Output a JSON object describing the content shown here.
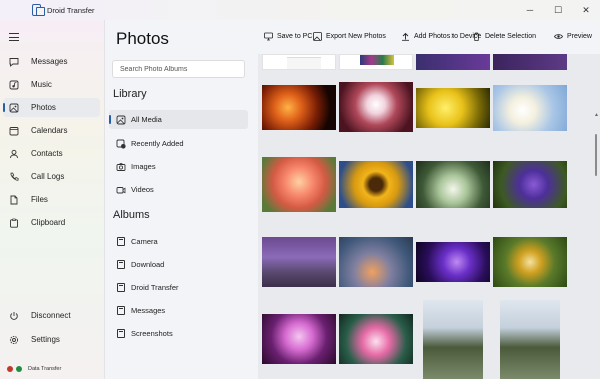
{
  "window": {
    "title": "Droid Transfer",
    "minimize_icon": "minimize-icon",
    "maximize_icon": "maximize-icon",
    "close_icon": "close-icon"
  },
  "sidebar": {
    "items": [
      {
        "label": "Messages",
        "icon": "message-icon"
      },
      {
        "label": "Music",
        "icon": "music-icon"
      },
      {
        "label": "Photos",
        "icon": "photos-icon",
        "active": true
      },
      {
        "label": "Calendars",
        "icon": "calendar-icon"
      },
      {
        "label": "Contacts",
        "icon": "contacts-icon"
      },
      {
        "label": "Call Logs",
        "icon": "phone-icon"
      },
      {
        "label": "Files",
        "icon": "files-icon"
      },
      {
        "label": "Clipboard",
        "icon": "clipboard-icon"
      }
    ],
    "bottom": [
      {
        "label": "Disconnect",
        "icon": "power-icon"
      },
      {
        "label": "Settings",
        "icon": "gear-icon"
      }
    ],
    "status": {
      "text": "Data Transfer",
      "colors": [
        "#c0392b",
        "#1e8e3e"
      ]
    }
  },
  "panel": {
    "title": "Photos",
    "search_placeholder": "Search Photo Albums",
    "library_heading": "Library",
    "library": [
      {
        "label": "All Media",
        "active": true
      },
      {
        "label": "Recently Added"
      },
      {
        "label": "Images"
      },
      {
        "label": "Videos"
      }
    ],
    "albums_heading": "Albums",
    "albums": [
      "Camera",
      "Download",
      "Droid Transfer",
      "Messages",
      "Screenshots"
    ]
  },
  "toolbar": {
    "save": "Save to PC",
    "export": "Export New Photos",
    "add": "Add Photos to Device",
    "delete": "Delete Selection",
    "preview": "Preview"
  },
  "colors": {
    "accent": "#2b5ca8",
    "background": "#e9eaed"
  }
}
